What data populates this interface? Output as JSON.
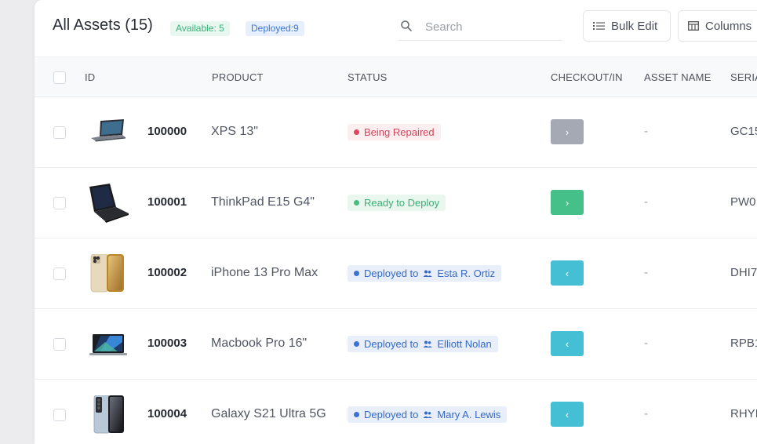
{
  "header": {
    "title": "All Assets (15)",
    "available_badge": "Available: 5",
    "deployed_badge": "Deployed:9",
    "search_placeholder": "Search",
    "bulk_edit_label": "Bulk Edit",
    "columns_label": "Columns"
  },
  "table": {
    "columns": [
      "ID",
      "PRODUCT",
      "STATUS",
      "CHECKOUT/IN",
      "ASSET NAME",
      "SERIA"
    ],
    "rows": [
      {
        "id": "100000",
        "product": "XPS 13\"",
        "status_text": "Being Repaired",
        "status_user": "",
        "status_kind": "repair",
        "action": "›",
        "action_kind": "gray",
        "asset_name": "-",
        "serial": "GC15",
        "thumb": "laptop-dell-icon"
      },
      {
        "id": "100001",
        "product": "ThinkPad E15 G4\"",
        "status_text": "Ready to Deploy",
        "status_user": "",
        "status_kind": "ready",
        "action": "›",
        "action_kind": "green",
        "asset_name": "-",
        "serial": "PW0",
        "thumb": "laptop-thinkpad-icon"
      },
      {
        "id": "100002",
        "product": "iPhone 13 Pro Max",
        "status_text": "Deployed to",
        "status_user": "Esta R. Ortiz",
        "status_kind": "deployed",
        "action": "‹",
        "action_kind": "teal",
        "asset_name": "-",
        "serial": "DHI7",
        "thumb": "phone-iphone-icon"
      },
      {
        "id": "100003",
        "product": "Macbook Pro 16\"",
        "status_text": "Deployed to",
        "status_user": "Elliott Nolan",
        "status_kind": "deployed",
        "action": "‹",
        "action_kind": "teal",
        "asset_name": "-",
        "serial": "RPB1",
        "thumb": "laptop-macbook-icon"
      },
      {
        "id": "100004",
        "product": "Galaxy S21 Ultra 5G",
        "status_text": "Deployed to",
        "status_user": "Mary A. Lewis",
        "status_kind": "deployed",
        "action": "‹",
        "action_kind": "teal",
        "asset_name": "-",
        "serial": "RHYI",
        "thumb": "phone-galaxy-icon"
      }
    ]
  },
  "colors": {
    "repair": "#e0465c",
    "ready": "#45bd7f",
    "deployed": "#3a72d6",
    "checkout_gray": "#a4a9b4",
    "checkout_green": "#44c088",
    "checkin_teal": "#45bfd4"
  }
}
